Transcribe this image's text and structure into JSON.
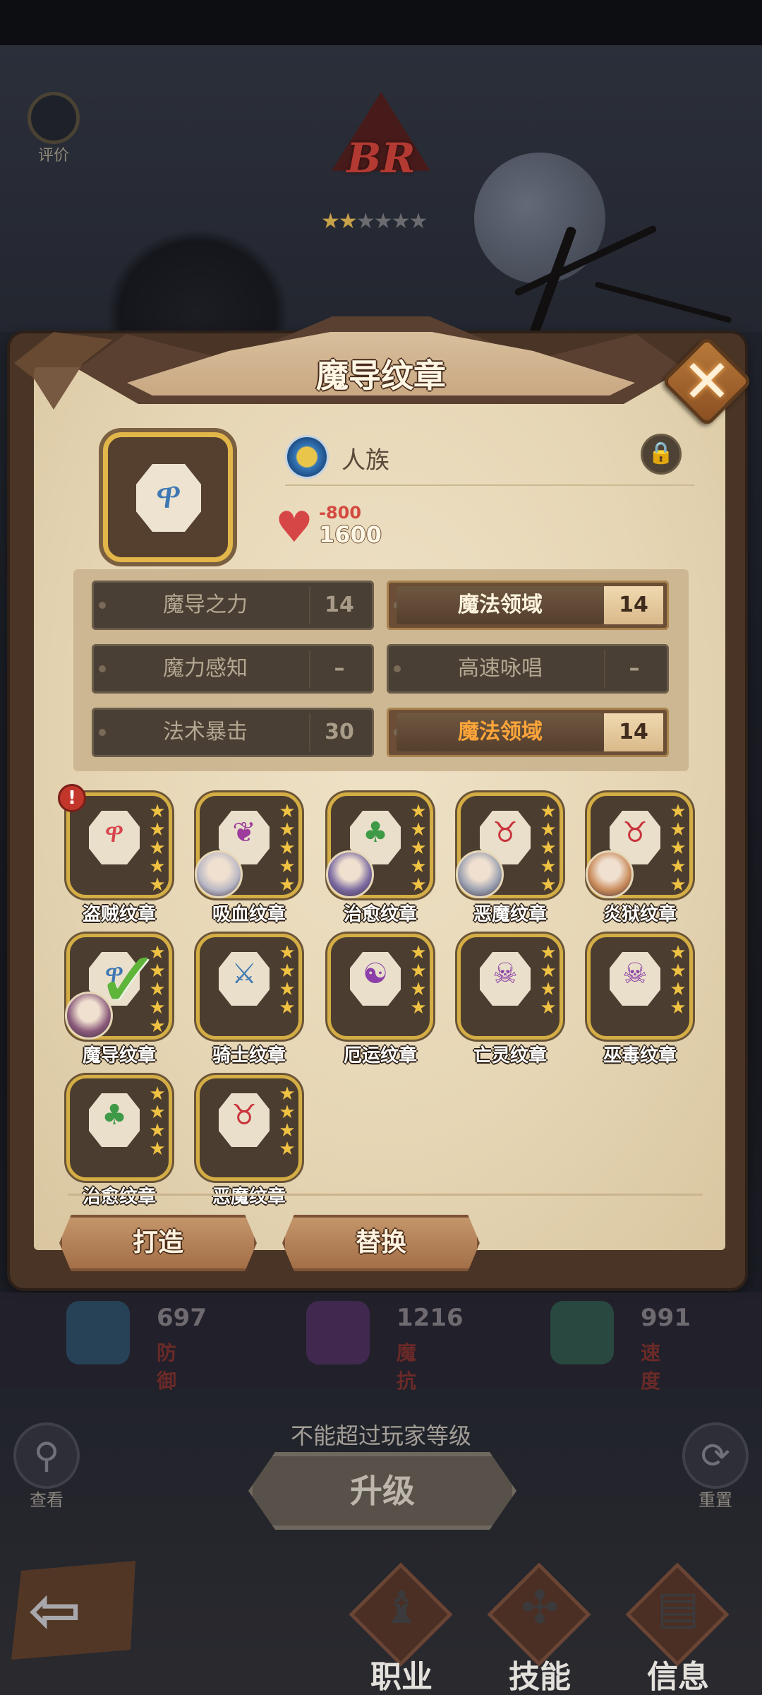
{
  "top": {
    "rate_label": "评价",
    "rank_text": "BR",
    "rank_stars": {
      "filled": 2,
      "total": 6
    }
  },
  "popup": {
    "title": "魔导纹章",
    "close_glyph": "✕",
    "main_emblem_icon": "mage-emblem-icon",
    "race": "人族",
    "lock_icon": "lock-icon",
    "hp_cost": "-800",
    "hp_value": "1600",
    "skills": [
      {
        "name": "魔导之力",
        "value": "14",
        "active": false
      },
      {
        "name": "魔法领域",
        "value": "14",
        "active": true
      },
      {
        "name": "魔力感知",
        "value": "–",
        "active": false
      },
      {
        "name": "高速咏唱",
        "value": "–",
        "active": false
      },
      {
        "name": "法术暴击",
        "value": "30",
        "active": false
      },
      {
        "name": "魔法领域",
        "value": "14",
        "active": true,
        "highlight_color": "#ffa53a"
      }
    ],
    "emblems": [
      {
        "label": "盗贼纹章",
        "stars": 5,
        "symbol": "ዋ",
        "color": "#d8434b",
        "alert": true
      },
      {
        "label": "吸血纹章",
        "stars": 5,
        "symbol": "❦",
        "color": "#9d3c9c",
        "avatar": true
      },
      {
        "label": "治愈纹章",
        "stars": 5,
        "symbol": "♣",
        "color": "#3f9a48",
        "avatar": true
      },
      {
        "label": "恶魔纹章",
        "stars": 5,
        "symbol": "♉",
        "color": "#c9343c",
        "avatar": true
      },
      {
        "label": "炎狱纹章",
        "stars": 5,
        "symbol": "♉",
        "color": "#c9343c",
        "avatar": true
      },
      {
        "label": "魔导纹章",
        "stars": 5,
        "symbol": "ዋ",
        "color": "#3e78b4",
        "avatar": true,
        "selected": true
      },
      {
        "label": "骑士纹章",
        "stars": 4,
        "symbol": "⚔",
        "color": "#3e78b4"
      },
      {
        "label": "厄运纹章",
        "stars": 4,
        "symbol": "☯",
        "color": "#8c3fa8"
      },
      {
        "label": "亡灵纹章",
        "stars": 4,
        "symbol": "☠",
        "color": "#8c3fa8"
      },
      {
        "label": "巫毒纹章",
        "stars": 4,
        "symbol": "☠",
        "color": "#8c3fa8"
      },
      {
        "label": "治愈纹章",
        "stars": 4,
        "symbol": "♣",
        "color": "#3f9a48"
      },
      {
        "label": "恶魔纹章",
        "stars": 4,
        "symbol": "♉",
        "color": "#c9343c"
      }
    ],
    "forge_label": "打造",
    "replace_label": "替换"
  },
  "stats": [
    {
      "value": "697",
      "label": "防御",
      "icon": "shield-icon",
      "color": "#2c5c7a"
    },
    {
      "value": "1216",
      "label": "魔抗",
      "icon": "magic-resist-icon",
      "color": "#5a2f6e"
    },
    {
      "value": "991",
      "label": "速度",
      "icon": "boot-icon",
      "color": "#2d6a52"
    }
  ],
  "bottom": {
    "hint": "不能超过玩家等级",
    "upgrade_label": "升级",
    "view_label": "查看",
    "reset_label": "重置",
    "tabs": [
      {
        "label": "职业",
        "icon": "class-icon"
      },
      {
        "label": "技能",
        "icon": "skill-icon"
      },
      {
        "label": "信息",
        "icon": "info-icon"
      }
    ]
  }
}
